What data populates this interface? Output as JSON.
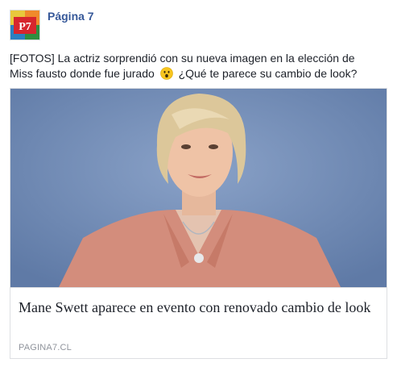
{
  "post": {
    "page_name": "Página 7",
    "avatar_text": "P7",
    "text_before_emoji": "[FOTOS] La actriz sorprendió con su nueva imagen en la elección de Miss fausto donde fue jurado",
    "emoji": "surprised-face-emoji",
    "text_after_emoji": "¿Qué te parece su cambio de look?"
  },
  "link_card": {
    "title": "Mane Swett aparece en evento con renovado cambio de look",
    "domain": "PAGINA7.CL"
  },
  "colors": {
    "page_name": "#365899",
    "avatar_bg": "#e8c93c",
    "avatar_red": "#d7262d",
    "image_bg": "#6e89b4",
    "blouse": "#d38d7c",
    "hair": "#dcc79a"
  }
}
